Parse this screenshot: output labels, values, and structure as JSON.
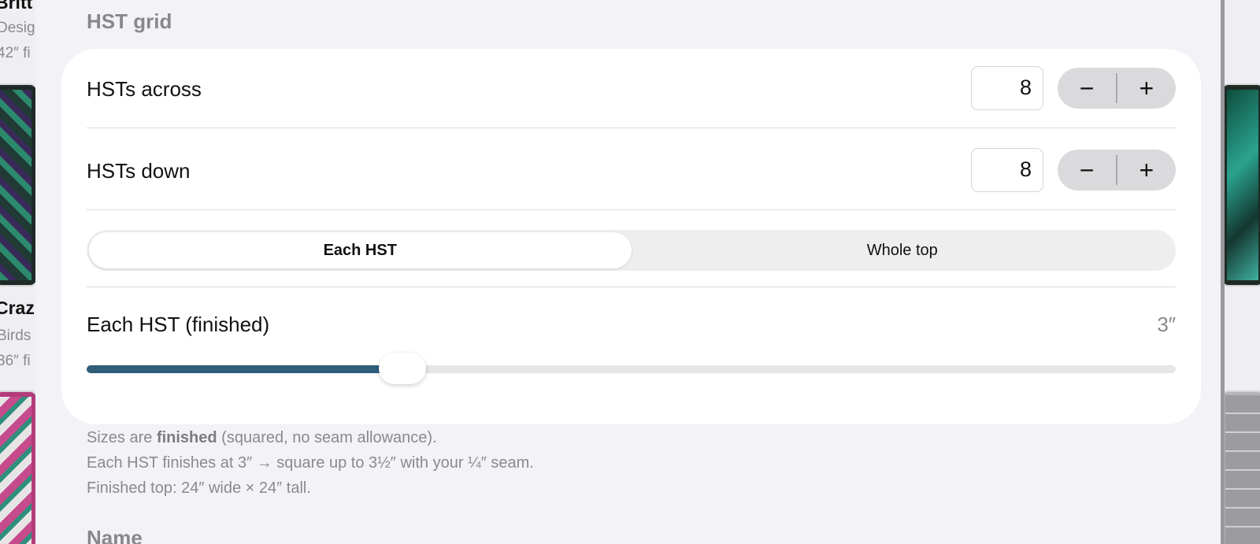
{
  "background": {
    "item_1_title": "Britt",
    "item_1_sub": "Desig",
    "item_1_size": "42″ fi",
    "item_2_title": "Craz",
    "item_2_sub": "Birds",
    "item_2_size": "36″ fi"
  },
  "section": {
    "header": "HST grid",
    "next_header": "Name"
  },
  "rows": {
    "across": {
      "label": "HSTs across",
      "value": "8",
      "minus": "−",
      "plus": "+"
    },
    "down": {
      "label": "HSTs down",
      "value": "8",
      "minus": "−",
      "plus": "+"
    }
  },
  "segment": {
    "options": [
      "Each HST",
      "Whole top"
    ],
    "selected": "Each HST"
  },
  "size": {
    "label": "Each HST (finished)",
    "value": "3″",
    "slider_fraction": 0.29
  },
  "footer": {
    "line1_pre": "Sizes are ",
    "line1_bold": "finished",
    "line1_post": " (squared, no seam allowance).",
    "line2": "Each HST finishes at 3″ → square up to 3½″ with your ¼″ seam.",
    "line3": "Finished top: 24″ wide × 24″ tall."
  },
  "colors": {
    "slider_fill": "#2f5d7a",
    "sheet_bg": "#f2f2f7",
    "card_bg": "#ffffff"
  }
}
